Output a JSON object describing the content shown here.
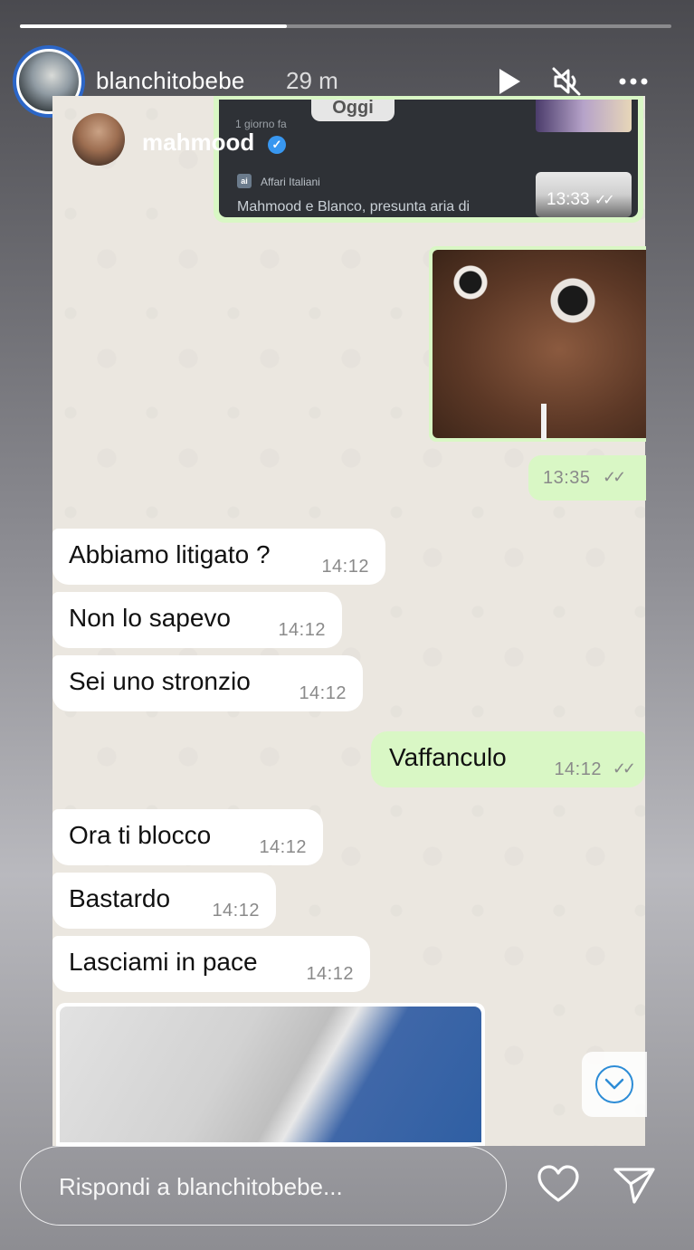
{
  "story": {
    "progress": 0.41,
    "username": "blanchitobebe",
    "time_ago": "29 m",
    "controls": {
      "play_icon": "play-icon",
      "mute_icon": "muted-speaker-icon",
      "more_icon": "more-dots-icon"
    }
  },
  "chat": {
    "contact_name": "mahmood",
    "quoted": {
      "date_pill": "Oggi",
      "sub": "1 giorno fa",
      "source": "Affari Italiani",
      "source_icon_label": "ai",
      "headline": "Mahmood e Blanco, presunta aria di",
      "time": "13:33",
      "ticks": "✓✓"
    },
    "image_message": {
      "time": "13:35",
      "ticks": "✓✓"
    },
    "messages": [
      {
        "dir": "in",
        "text": "Abbiamo litigato ?",
        "time": "14:12"
      },
      {
        "dir": "in",
        "text": "Non lo sapevo",
        "time": "14:12"
      },
      {
        "dir": "in",
        "text": "Sei uno stronzio",
        "time": "14:12"
      },
      {
        "dir": "out",
        "text": "Vaffanculo",
        "time": "14:12",
        "ticks": "✓✓"
      },
      {
        "dir": "in",
        "text": "Ora ti blocco",
        "time": "14:12"
      },
      {
        "dir": "in",
        "text": "Bastardo",
        "time": "14:12"
      },
      {
        "dir": "in",
        "text": "Lasciami in pace",
        "time": "14:12"
      }
    ]
  },
  "reply": {
    "placeholder": "Rispondi a blanchitobebe...",
    "like_icon": "heart-icon",
    "share_icon": "send-icon"
  },
  "colors": {
    "outgoing_bubble": "#d9f7c5",
    "incoming_bubble": "#ffffff",
    "verified": "#3897f0",
    "avatar_ring": "#2c66c7"
  }
}
